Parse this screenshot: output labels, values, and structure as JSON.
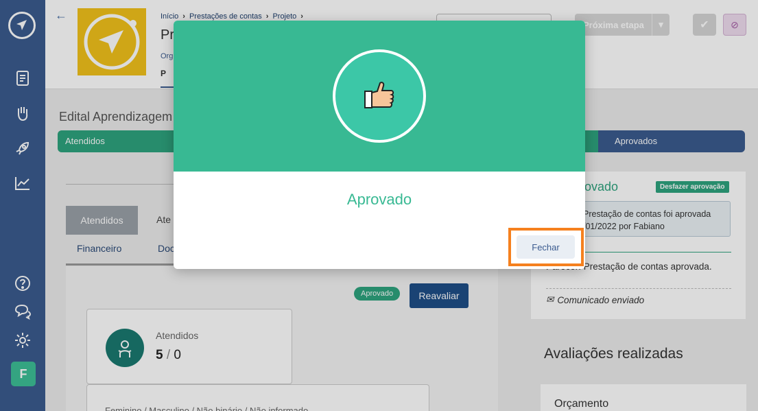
{
  "sidebar": {
    "avatar_letter": "F",
    "icons": [
      "logo-icon",
      "document-icon",
      "hand-heart-icon",
      "rocket-icon",
      "chart-icon",
      "help-icon",
      "chat-icon",
      "gear-icon"
    ]
  },
  "header": {
    "breadcrumb": [
      "Início",
      "Prestações de contas",
      "Projeto"
    ],
    "title_partial": "Pr",
    "org_partial": "Org",
    "tab_partial": "P",
    "next_button": "Próxima etapa"
  },
  "main": {
    "edital_title": "Edital Aprendizagem",
    "pipeline": {
      "first_stage": "Atendidos",
      "last_stage": "Aprovados"
    },
    "tabs": [
      "Atendidos",
      "Ate"
    ],
    "subtabs": [
      "Financeiro",
      "Doc"
    ],
    "status_badge": "Aprovado",
    "reavaliar_button": "Reavaliar",
    "card": {
      "label": "Atendidos",
      "value": "5",
      "separator": "/",
      "total": "0"
    },
    "gender_label": "Feminino / Masculino / Não binário / Não informado"
  },
  "right": {
    "title_partial": "ovado",
    "undo_button": "Desfazer aprovação",
    "info_line1": "Prestação de contas foi aprovada",
    "info_line2": "/01/2022 por Fabiano",
    "message": "Parecer: Prestação de contas aprovada.",
    "sent": "Comunicado enviado",
    "evaluations_title": "Avaliações realizadas",
    "budget_label": "Orçamento"
  },
  "modal": {
    "title": "Aprovado",
    "close_button": "Fechar"
  },
  "colors": {
    "brand_green": "#38b993",
    "sidebar": "#3b5b8f",
    "highlight": "#f5801e"
  }
}
